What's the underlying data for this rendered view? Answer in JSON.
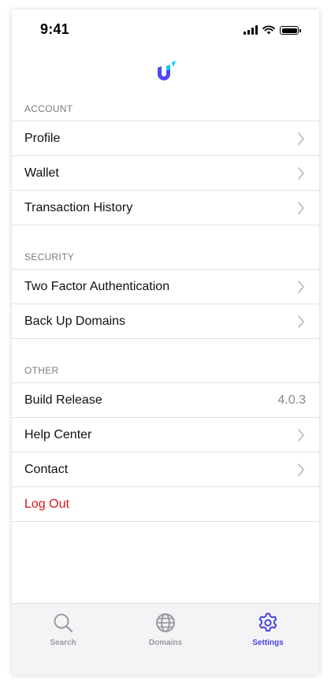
{
  "status_bar": {
    "time": "9:41"
  },
  "app": {
    "logo_icon": "unstoppable-u-logo"
  },
  "sections": {
    "account": {
      "header": "ACCOUNT",
      "items": [
        {
          "label": "Profile"
        },
        {
          "label": "Wallet"
        },
        {
          "label": "Transaction History"
        }
      ]
    },
    "security": {
      "header": "SECURITY",
      "items": [
        {
          "label": "Two Factor Authentication"
        },
        {
          "label": "Back Up Domains"
        }
      ]
    },
    "other": {
      "header": "OTHER",
      "build_release": {
        "label": "Build Release",
        "value": "4.0.3"
      },
      "items": [
        {
          "label": "Help Center"
        },
        {
          "label": "Contact"
        }
      ],
      "logout": {
        "label": "Log Out"
      }
    }
  },
  "tab_bar": {
    "tabs": [
      {
        "label": "Search",
        "icon": "search-icon",
        "active": false
      },
      {
        "label": "Domains",
        "icon": "globe-icon",
        "active": false
      },
      {
        "label": "Settings",
        "icon": "gear-icon",
        "active": true
      }
    ]
  },
  "colors": {
    "accent": "#4a45e4",
    "danger": "#e0141e",
    "logo_blue": "#4c47f7",
    "logo_cyan": "#00c9ff"
  }
}
